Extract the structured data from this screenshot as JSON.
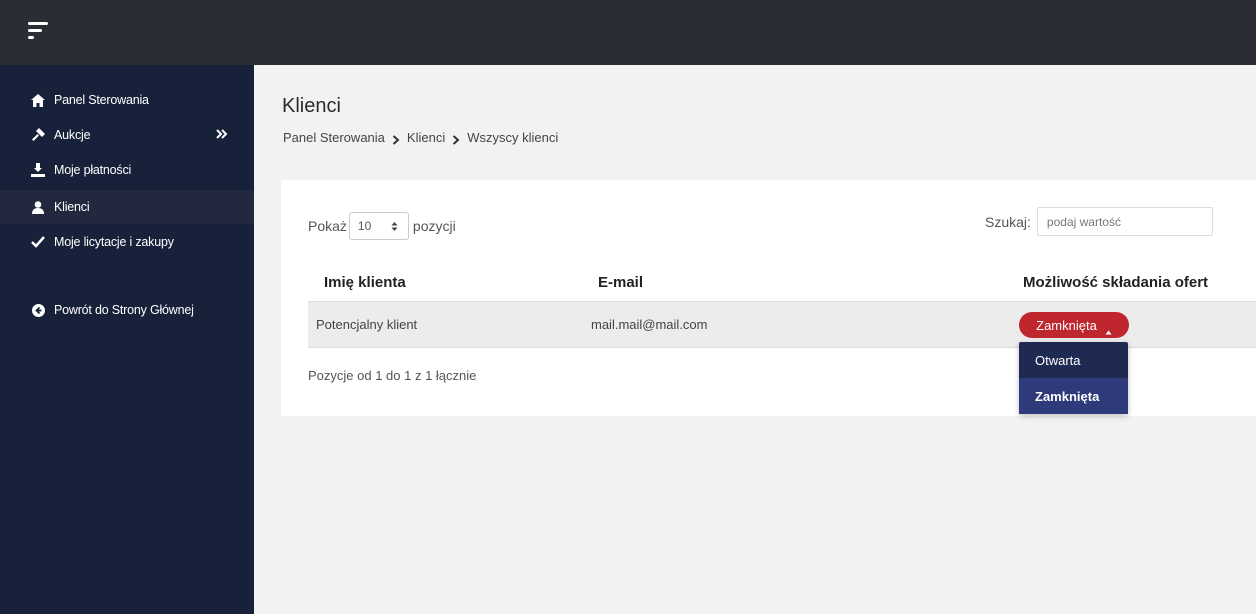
{
  "sidebar": {
    "items": [
      {
        "label": "Panel Sterowania",
        "icon": "home-icon"
      },
      {
        "label": "Aukcje",
        "icon": "gavel-icon"
      },
      {
        "label": "Moje płatności",
        "icon": "payment-icon"
      },
      {
        "label": "Klienci",
        "icon": "user-icon"
      },
      {
        "label": "Moje licytacje i zakupy",
        "icon": "check-icon"
      },
      {
        "label": "Powrót do Strony Głównej",
        "icon": "back-arrow-icon"
      }
    ]
  },
  "main": {
    "title": "Klienci",
    "breadcrumb": [
      "Panel Sterowania",
      "Klienci",
      "Wszyscy klienci"
    ]
  },
  "table_controls": {
    "show_label": "Pokaż",
    "show_value": "10",
    "show_suffix": "pozycji",
    "search_label": "Szukaj:",
    "search_placeholder": "podaj wartość"
  },
  "table": {
    "headers": [
      "Imię klienta",
      "E-mail",
      "Możliwość składania ofert"
    ],
    "rows": [
      {
        "name": "Potencjalny klient",
        "email": "mail.mail@mail.com",
        "status": "Zamknięta"
      }
    ],
    "footer": "Pozycje od 1 do 1 z 1 łącznie"
  },
  "dropdown": {
    "options": [
      "Otwarta",
      "Zamknięta"
    ],
    "selected": "Zamknięta"
  },
  "colors": {
    "topbar": "#2a2d33",
    "sidebar": "#17213a",
    "status_closed": "#c0262d",
    "dropdown": "#1e2a52",
    "dropdown_selected": "#2e3a7a"
  }
}
